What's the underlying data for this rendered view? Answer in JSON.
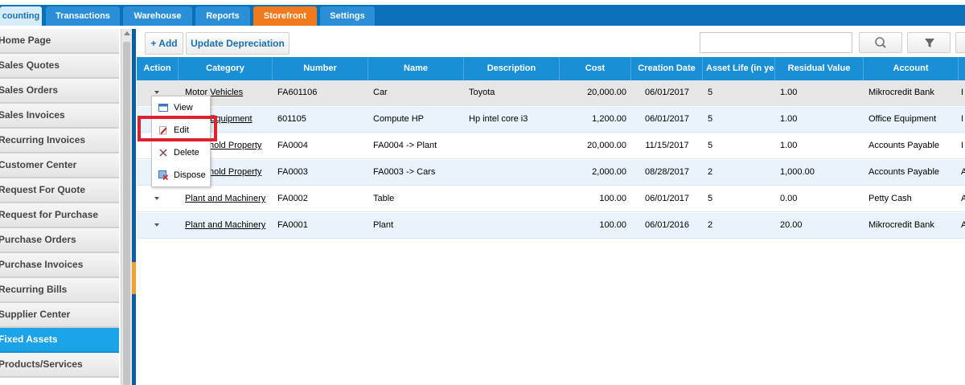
{
  "tabs": [
    {
      "label": "counting"
    },
    {
      "label": "Transactions"
    },
    {
      "label": "Warehouse"
    },
    {
      "label": "Reports"
    },
    {
      "label": "Storefront"
    },
    {
      "label": "Settings"
    }
  ],
  "sidebar": {
    "items": [
      {
        "label": "Home Page"
      },
      {
        "label": "Sales Quotes"
      },
      {
        "label": "Sales Orders"
      },
      {
        "label": "Sales Invoices"
      },
      {
        "label": "Recurring Invoices"
      },
      {
        "label": "Customer Center"
      },
      {
        "label": "Request For Quote"
      },
      {
        "label": "Request for Purchase"
      },
      {
        "label": "Purchase Orders"
      },
      {
        "label": "Purchase Invoices"
      },
      {
        "label": "Recurring Bills"
      },
      {
        "label": "Supplier Center"
      },
      {
        "label": "Fixed Assets"
      },
      {
        "label": "Products/Services"
      }
    ]
  },
  "toolbar": {
    "add_label": "+ Add",
    "depreciation_label": "Update Depreciation",
    "search_value": ""
  },
  "columns": [
    "Action",
    "Category",
    "Number",
    "Name",
    "Description",
    "Cost",
    "Creation Date",
    "Asset Life (in yea",
    "Residual Value",
    "Account",
    ""
  ],
  "rows": [
    {
      "category": "Motor Vehicles",
      "number": "FA601106",
      "name": "Car",
      "description": "Toyota",
      "cost": "20,000.00",
      "date": "06/01/2017",
      "life": "5",
      "residual": "1.00",
      "account": "Mikrocredit Bank",
      "extra": "I"
    },
    {
      "category": "Equipment",
      "number": "601105",
      "name": "Compute HP",
      "description": "Hp intel core i3",
      "cost": "1,200.00",
      "date": "06/01/2017",
      "life": "5",
      "residual": "1.00",
      "account": "Office Equipment",
      "extra": "I"
    },
    {
      "category": "hold Property",
      "number": "FA0004",
      "name": "FA0004 -> Plant",
      "description": "",
      "cost": "20,000.00",
      "date": "11/15/2017",
      "life": "5",
      "residual": "1.00",
      "account": "Accounts Payable",
      "extra": "I"
    },
    {
      "category": "hold Property",
      "number": "FA0003",
      "name": "FA0003 -> Cars",
      "description": "",
      "cost": "2,000.00",
      "date": "08/28/2017",
      "life": "2",
      "residual": "1,000.00",
      "account": "Accounts Payable",
      "extra": "A"
    },
    {
      "category": "Plant and Machinery",
      "number": "FA0002",
      "name": "Table",
      "description": "",
      "cost": "100.00",
      "date": "06/01/2017",
      "life": "5",
      "residual": "0.00",
      "account": "Petty Cash",
      "extra": "A"
    },
    {
      "category": "Plant and Machinery",
      "number": "FA0001",
      "name": "Plant",
      "description": "",
      "cost": "100.00",
      "date": "06/01/2016",
      "life": "2",
      "residual": "20.00",
      "account": "Mikrocredit Bank",
      "extra": "A"
    }
  ],
  "context_menu": {
    "items": [
      {
        "label": "View",
        "icon": "window-icon"
      },
      {
        "label": "Edit",
        "icon": "edit-icon"
      },
      {
        "label": "Delete",
        "icon": "scissors-icon"
      },
      {
        "label": "Dispose",
        "icon": "dispose-icon"
      }
    ]
  },
  "colors": {
    "accent": "#1b8fd6",
    "tabbar": "#0a70b8",
    "storefront": "#f07a1c",
    "sidebar_active": "#1aa3e8",
    "highlight": "#e0202a"
  }
}
